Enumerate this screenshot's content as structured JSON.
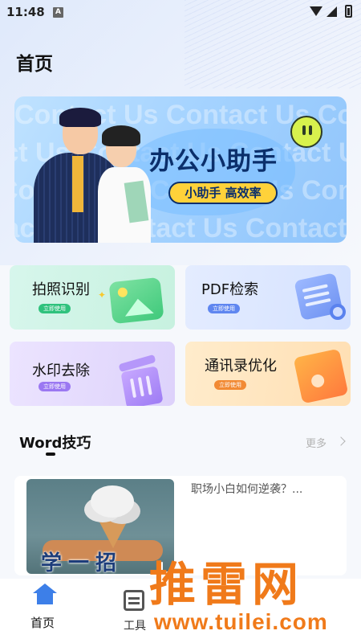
{
  "status_bar": {
    "time": "11:48",
    "notification_letter": "A",
    "icons": [
      "wifi-icon",
      "signal-icon",
      "battery-icon"
    ]
  },
  "header": {
    "title": "首页"
  },
  "banner": {
    "title": "办公小助手",
    "subtitle": "小助手 高效率",
    "background_text": "Contact Us Contact Us Contact Us Contact Us Contact Us Contact Us",
    "colors": {
      "accent": "#ffd23a",
      "text": "#0b2f6b"
    }
  },
  "features": [
    {
      "label": "拍照识别",
      "tag": "立即使用",
      "icon": "photo-icon",
      "tag_color": "#2fc27d"
    },
    {
      "label": "PDF检索",
      "tag": "立即使用",
      "icon": "document-search-icon",
      "tag_color": "#5f86f0"
    },
    {
      "label": "水印去除",
      "tag": "立即使用",
      "icon": "trash-icon",
      "tag_color": "#9b78f2"
    },
    {
      "label": "通讯录优化",
      "tag": "立即使用",
      "icon": "contacts-icon",
      "tag_color": "#f28a34"
    }
  ],
  "word_tips": {
    "title": "Word技巧",
    "more_label": "更多",
    "articles": [
      {
        "title": "职场小白如何逆袭？...",
        "thumb_text": "学一招"
      }
    ]
  },
  "bottom_nav": {
    "items": [
      {
        "label": "首页",
        "icon": "home-icon",
        "active": true
      },
      {
        "label": "工具",
        "icon": "tools-icon",
        "active": false
      }
    ],
    "active_color": "#3d7fe8"
  },
  "watermark": {
    "name": "推雷网",
    "url": "www.tuilei.com"
  }
}
